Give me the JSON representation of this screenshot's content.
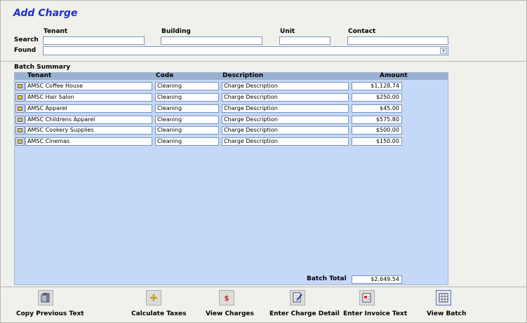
{
  "form_title": "Add Charge",
  "search": {
    "tenant_label": "Tenant",
    "building_label": "Building",
    "unit_label": "Unit",
    "contact_label": "Contact",
    "search_label": "Search",
    "found_label": "Found",
    "tenant_value": "",
    "building_value": "",
    "unit_value": "",
    "contact_value": "",
    "found_value": ""
  },
  "batch": {
    "section_label": "Batch Summary",
    "columns": {
      "tenant": "Tenant",
      "code": "Code",
      "description": "Description",
      "amount": "Amount"
    },
    "rows": [
      {
        "tenant": "AMSC Coffee House",
        "code": "Cleaning",
        "description": "Charge Description",
        "amount": "$1,128.74"
      },
      {
        "tenant": "AMSC Hair Salon",
        "code": "Cleaning",
        "description": "Charge Description",
        "amount": "$250.00"
      },
      {
        "tenant": "AMSC Apparel",
        "code": "Cleaning",
        "description": "Charge Description",
        "amount": "$45.00"
      },
      {
        "tenant": "AMSC Childrens Apparel",
        "code": "Cleaning",
        "description": "Charge Description",
        "amount": "$575.80"
      },
      {
        "tenant": "AMSC Cookery Supplies",
        "code": "Cleaning",
        "description": "Charge Description",
        "amount": "$500.00"
      },
      {
        "tenant": "AMSC Cinemas",
        "code": "Cleaning",
        "description": "Charge Description",
        "amount": "$150.00"
      }
    ],
    "total_label": "Batch Total",
    "total_value": "$2,649.54"
  },
  "toolbar": {
    "copy_previous_text": "Copy Previous Text",
    "calculate_taxes": "Calculate Taxes",
    "view_charges": "View Charges",
    "enter_charge_detail": "Enter Charge Detail",
    "enter_invoice_text": "Enter Invoice Text",
    "view_batch": "View Batch"
  },
  "colors": {
    "title": "#2030c0",
    "grid_bg": "#c4d8f8",
    "grid_header": "#9ab0d0"
  }
}
